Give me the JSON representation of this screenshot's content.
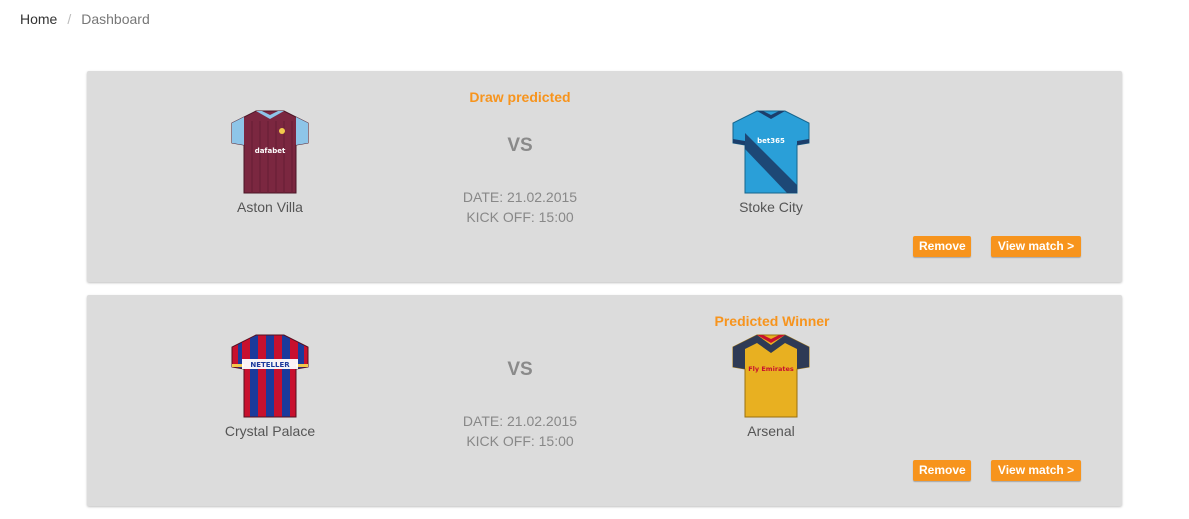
{
  "breadcrumb": {
    "home": "Home",
    "separator": "/",
    "current": "Dashboard"
  },
  "colors": {
    "accent": "#f7941d",
    "card_bg": "#dcdcdc"
  },
  "matches": [
    {
      "prediction_label": "Draw predicted",
      "prediction_position": "center",
      "home_team": {
        "name": "Aston Villa",
        "kit_icon": "aston-villa-shirt-icon",
        "sponsor": "dafabet"
      },
      "vs_label": "VS",
      "date": "DATE: 21.02.2015",
      "kickoff": "KICK OFF: 15:00",
      "away_team": {
        "name": "Stoke City",
        "kit_icon": "stoke-city-shirt-icon",
        "sponsor": "bet365"
      },
      "remove_label": "Remove",
      "view_label": "View match >"
    },
    {
      "prediction_label": "Predicted Winner",
      "prediction_position": "away",
      "home_team": {
        "name": "Crystal Palace",
        "kit_icon": "crystal-palace-shirt-icon",
        "sponsor": "NETELLER"
      },
      "vs_label": "VS",
      "date": "DATE: 21.02.2015",
      "kickoff": "KICK OFF: 15:00",
      "away_team": {
        "name": "Arsenal",
        "kit_icon": "arsenal-shirt-icon",
        "sponsor": "Fly Emirates"
      },
      "remove_label": "Remove",
      "view_label": "View match >"
    }
  ]
}
